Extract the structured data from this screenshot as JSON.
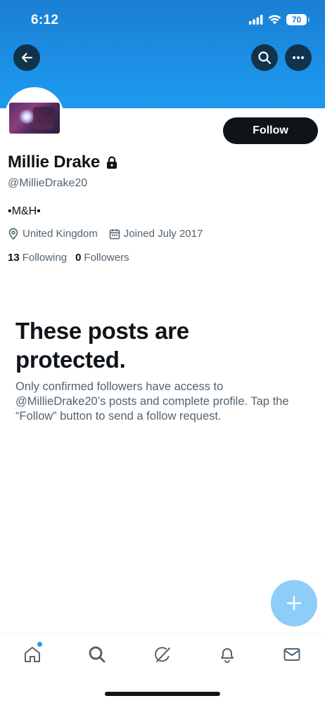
{
  "status_bar": {
    "time": "6:12",
    "battery": "70"
  },
  "profile": {
    "display_name": "Millie Drake",
    "handle": "@MillieDrake20",
    "bio": "•M&H•",
    "location": "United Kingdom",
    "joined": "Joined July 2017",
    "following_count": "13",
    "following_label": "Following",
    "followers_count": "0",
    "followers_label": "Followers",
    "follow_label": "Follow"
  },
  "protected": {
    "title": "These posts are protected.",
    "text": "Only confirmed followers have access to @MillieDrake20’s posts and complete profile. Tap the “Follow” button to send a follow request."
  },
  "icons": {
    "back": "back-arrow-icon",
    "search": "search-icon",
    "more": "more-icon",
    "lock": "lock-icon",
    "location": "location-pin-icon",
    "calendar": "calendar-icon",
    "compose": "plus-icon",
    "tabs": [
      "home-icon",
      "search-icon",
      "grok-icon",
      "bell-icon",
      "mail-icon"
    ]
  },
  "colors": {
    "banner": "#1d9bf0",
    "accent": "#1d9bf0",
    "fab": "#8ecdf8",
    "button": "#0f1419"
  }
}
